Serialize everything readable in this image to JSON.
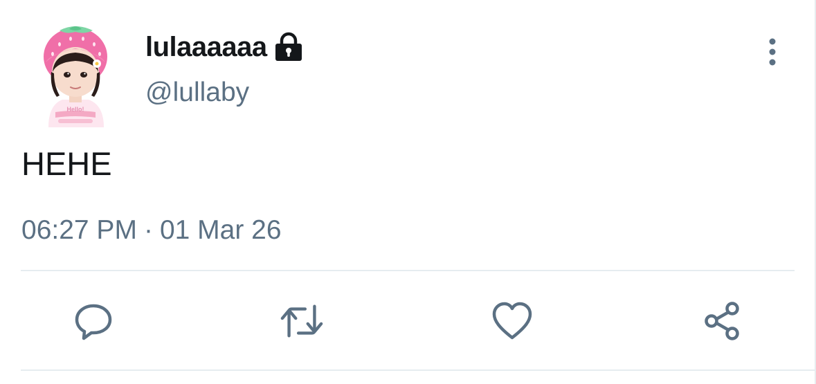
{
  "tweet": {
    "display_name": "lulaaaaaa",
    "handle": "@lullaby",
    "text": "HEHE",
    "time": "06:27 PM",
    "separator": "·",
    "date": "01 Mar 26",
    "protected": true,
    "avatar_shirt_text": "Hello!"
  },
  "icons": {
    "protected": "lock-icon",
    "more": "vertical-dots-icon",
    "reply": "speech-bubble-icon",
    "retweet": "retweet-arrows-icon",
    "like": "heart-icon",
    "share": "share-nodes-icon"
  },
  "colors": {
    "text_primary": "#14171a",
    "text_secondary": "#5b7083",
    "icon_gray": "#5b7083",
    "divider": "#e6ecf0",
    "background": "#ffffff"
  }
}
